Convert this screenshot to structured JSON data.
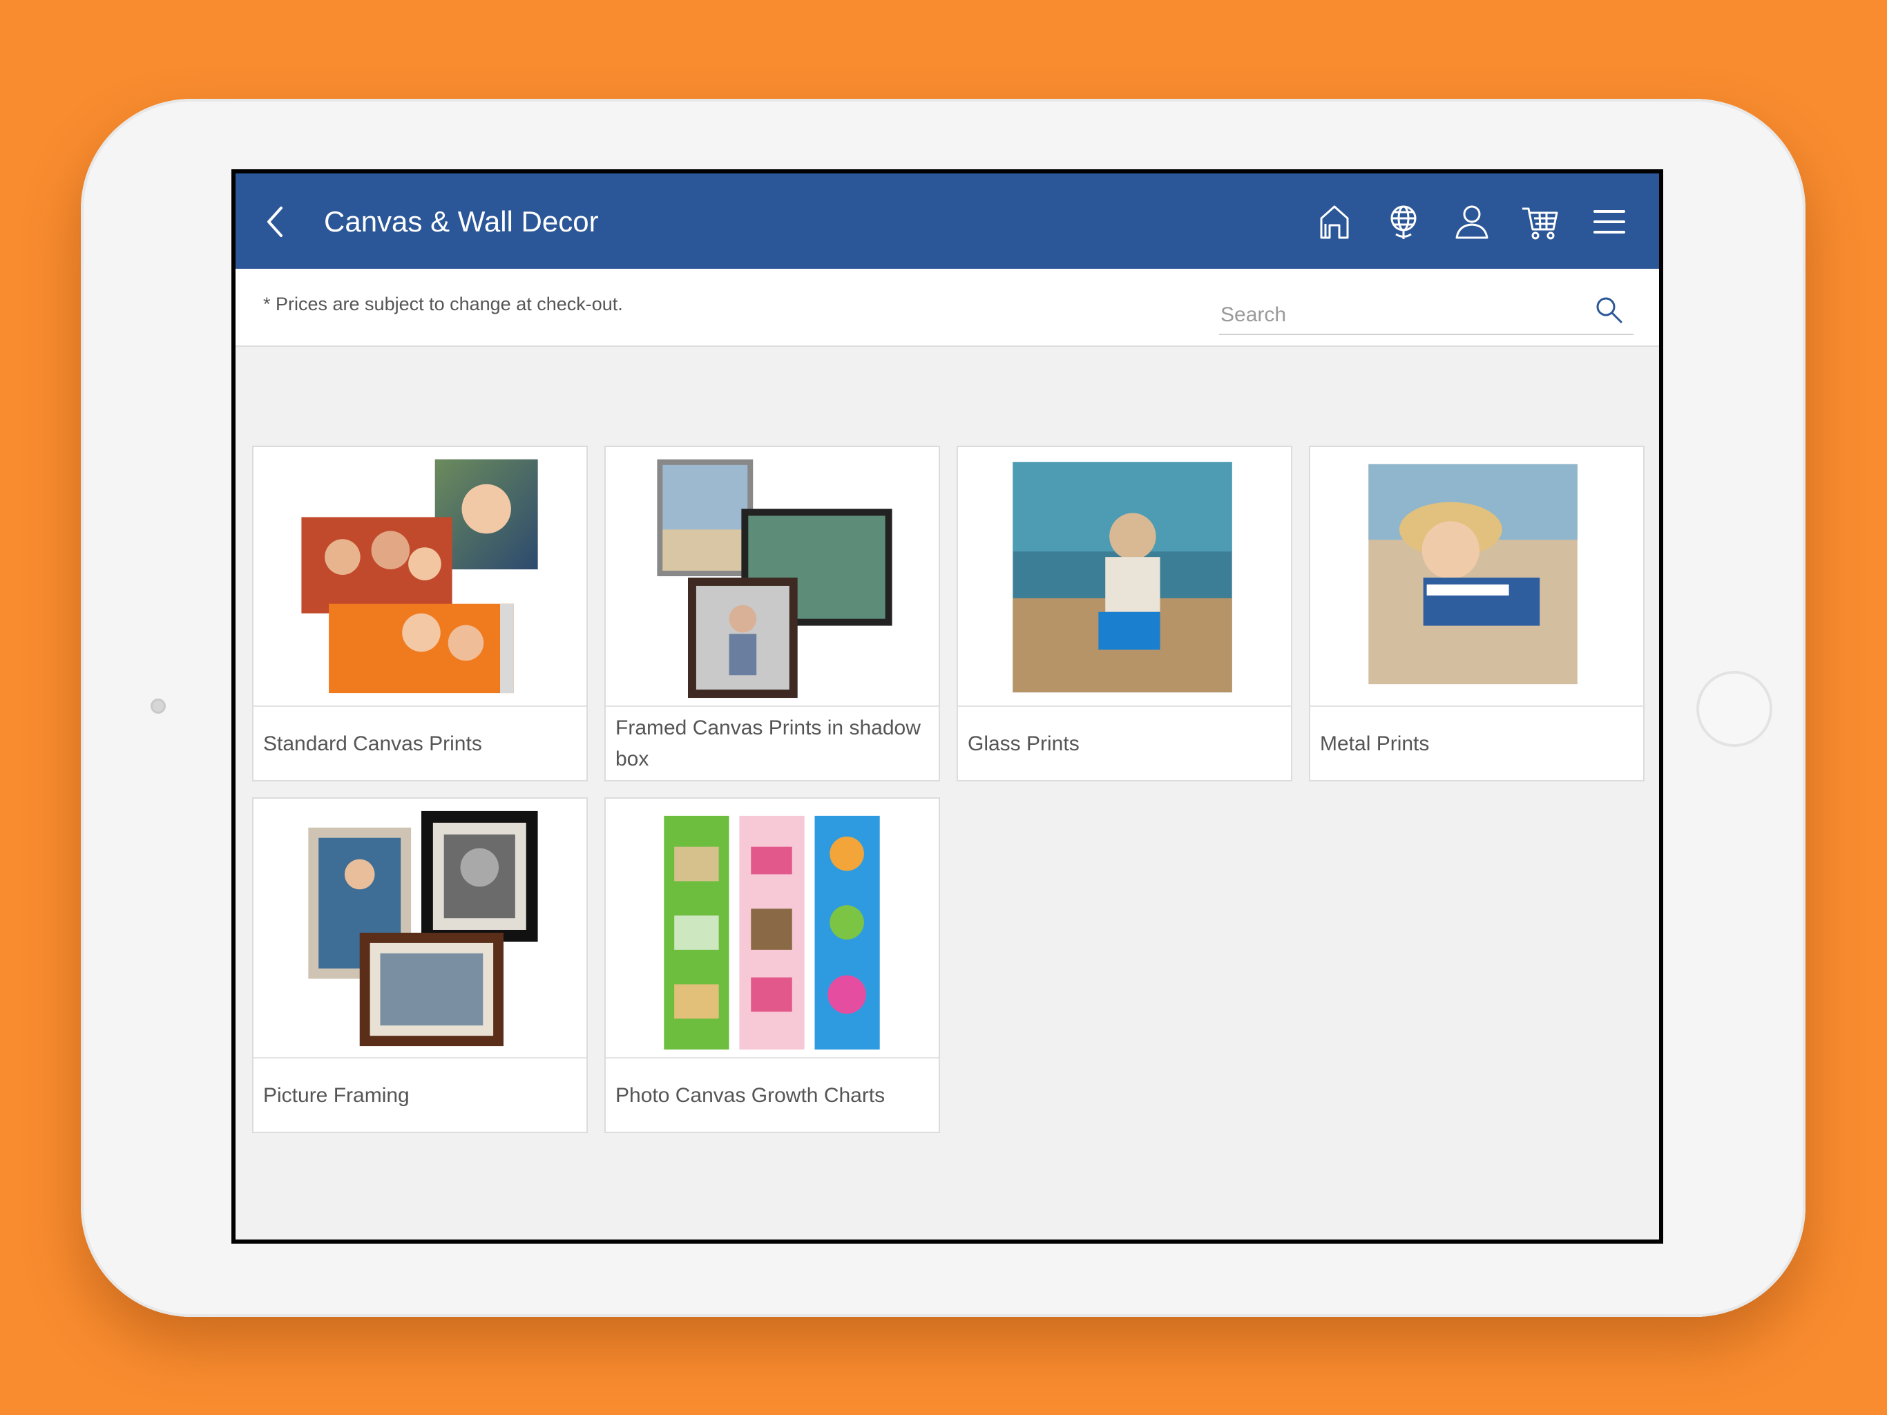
{
  "header": {
    "title": "Canvas & Wall Decor",
    "icons": [
      "back-chevron-icon",
      "home-icon",
      "globe-icon",
      "user-icon",
      "cart-icon",
      "hamburger-menu-icon"
    ]
  },
  "subheader": {
    "notice": "* Prices are subject to change at check-out.",
    "search_placeholder": "Search"
  },
  "products": [
    {
      "label": "Standard Canvas Prints"
    },
    {
      "label": "Framed Canvas Prints in shadow box"
    },
    {
      "label": "Glass Prints"
    },
    {
      "label": "Metal Prints"
    },
    {
      "label": "Picture Framing"
    },
    {
      "label": "Photo Canvas Growth Charts"
    }
  ],
  "colors": {
    "background": "#F98C2F",
    "app_bar": "#2B5697",
    "content_bg": "#F1F1F1"
  }
}
